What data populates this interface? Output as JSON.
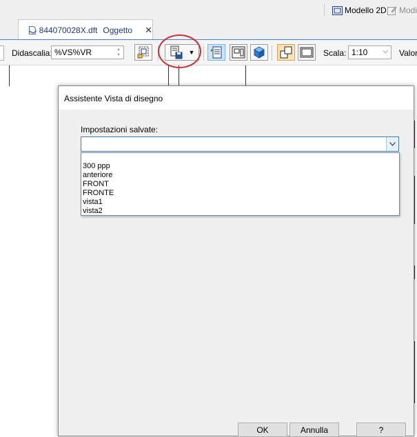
{
  "topbar": {
    "modello2d_label": "Modello 2D",
    "modifica_label": "Modifi"
  },
  "document_tab": {
    "filename": "844070028X.dft",
    "type": "Oggetto",
    "close_glyph": "✕"
  },
  "toolbar": {
    "caption_label": "Didascalia:",
    "caption_value": "%VS%VR",
    "scale_label": "Scala:",
    "scale_value": "1:10",
    "value_label": "Valor"
  },
  "dialog": {
    "title": "Assistente Vista di disegno",
    "saved_settings_label": "Impostazioni salvate:",
    "saved_settings_value": "",
    "options": [
      "300 ppp",
      "anteriore",
      "FRONT",
      "FRONTE",
      "vista1",
      "vista2"
    ],
    "ok_label": "OK",
    "cancel_label": "Annulla",
    "help_label": "?"
  },
  "icons": {
    "highlight_color": "#c83232",
    "accent_color": "#4a7cc4"
  }
}
